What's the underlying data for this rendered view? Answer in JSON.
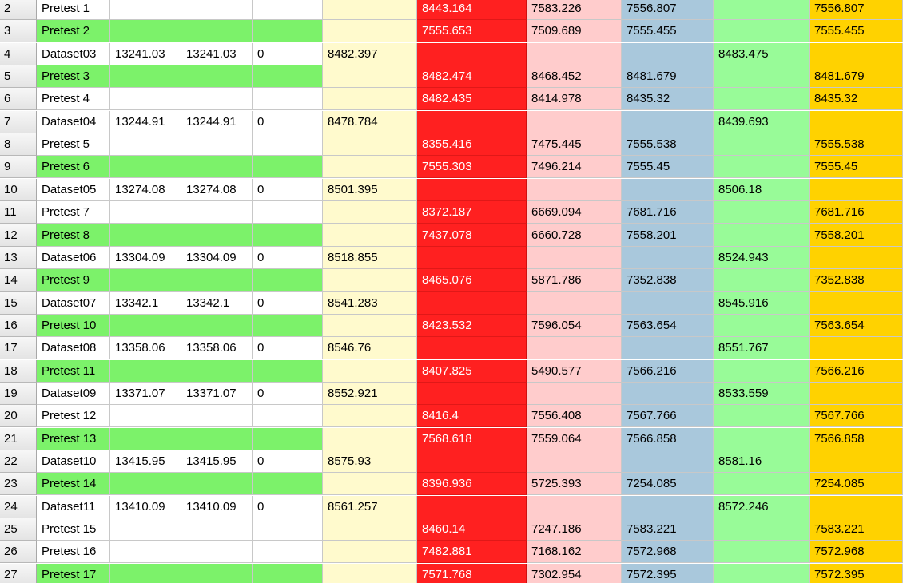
{
  "colors": {
    "row_highlight": "#7cf26a",
    "col_e": "#fffacd",
    "col_f": "#ff2020",
    "col_g": "#ffcccc",
    "col_h": "#a9c8dc",
    "col_i": "#98fb98",
    "col_j": "#ffd200"
  },
  "rows": [
    {
      "num": "2",
      "hl": false,
      "cells": [
        "Pretest  1",
        "",
        "",
        "",
        "",
        "8443.164",
        "7583.226",
        "7556.807",
        "",
        "7556.807"
      ]
    },
    {
      "num": "3",
      "hl": true,
      "cells": [
        "Pretest  2",
        "",
        "",
        "",
        "",
        "7555.653",
        "7509.689",
        "7555.455",
        "",
        "7555.455"
      ]
    },
    {
      "num": "4",
      "hl": false,
      "cells": [
        "Dataset03",
        "13241.03",
        "13241.03",
        "0",
        "8482.397",
        "",
        "",
        "",
        "8483.475",
        ""
      ]
    },
    {
      "num": "5",
      "hl": true,
      "cells": [
        "Pretest  3",
        "",
        "",
        "",
        "",
        "8482.474",
        "8468.452",
        "8481.679",
        "",
        "8481.679"
      ]
    },
    {
      "num": "6",
      "hl": false,
      "cells": [
        "Pretest  4",
        "",
        "",
        "",
        "",
        "8482.435",
        "8414.978",
        "8435.32",
        "",
        "8435.32"
      ]
    },
    {
      "num": "7",
      "hl": false,
      "cells": [
        "Dataset04",
        "13244.91",
        "13244.91",
        "0",
        "8478.784",
        "",
        "",
        "",
        "8439.693",
        ""
      ]
    },
    {
      "num": "8",
      "hl": false,
      "cells": [
        "Pretest  5",
        "",
        "",
        "",
        "",
        "8355.416",
        "7475.445",
        "7555.538",
        "",
        "7555.538"
      ]
    },
    {
      "num": "9",
      "hl": true,
      "cells": [
        "Pretest  6",
        "",
        "",
        "",
        "",
        "7555.303",
        "7496.214",
        "7555.45",
        "",
        "7555.45"
      ]
    },
    {
      "num": "10",
      "hl": false,
      "cells": [
        "Dataset05",
        "13274.08",
        "13274.08",
        "0",
        "8501.395",
        "",
        "",
        "",
        "8506.18",
        ""
      ]
    },
    {
      "num": "11",
      "hl": false,
      "cells": [
        "Pretest  7",
        "",
        "",
        "",
        "",
        "8372.187",
        "6669.094",
        "7681.716",
        "",
        "7681.716"
      ]
    },
    {
      "num": "12",
      "hl": true,
      "cells": [
        "Pretest  8",
        "",
        "",
        "",
        "",
        "7437.078",
        "6660.728",
        "7558.201",
        "",
        "7558.201"
      ]
    },
    {
      "num": "13",
      "hl": false,
      "cells": [
        "Dataset06",
        "13304.09",
        "13304.09",
        "0",
        "8518.855",
        "",
        "",
        "",
        "8524.943",
        ""
      ]
    },
    {
      "num": "14",
      "hl": true,
      "cells": [
        "Pretest  9",
        "",
        "",
        "",
        "",
        "8465.076",
        "5871.786",
        "7352.838",
        "",
        "7352.838"
      ]
    },
    {
      "num": "15",
      "hl": false,
      "cells": [
        "Dataset07",
        "13342.1",
        "13342.1",
        "0",
        "8541.283",
        "",
        "",
        "",
        "8545.916",
        ""
      ]
    },
    {
      "num": "16",
      "hl": true,
      "cells": [
        "Pretest  10",
        "",
        "",
        "",
        "",
        "8423.532",
        "7596.054",
        "7563.654",
        "",
        "7563.654"
      ]
    },
    {
      "num": "17",
      "hl": false,
      "cells": [
        "Dataset08",
        "13358.06",
        "13358.06",
        "0",
        "8546.76",
        "",
        "",
        "",
        "8551.767",
        ""
      ]
    },
    {
      "num": "18",
      "hl": true,
      "cells": [
        "Pretest  11",
        "",
        "",
        "",
        "",
        "8407.825",
        "5490.577",
        "7566.216",
        "",
        "7566.216"
      ]
    },
    {
      "num": "19",
      "hl": false,
      "cells": [
        "Dataset09",
        "13371.07",
        "13371.07",
        "0",
        "8552.921",
        "",
        "",
        "",
        "8533.559",
        ""
      ]
    },
    {
      "num": "20",
      "hl": false,
      "cells": [
        "Pretest  12",
        "",
        "",
        "",
        "",
        "8416.4",
        "7556.408",
        "7567.766",
        "",
        "7567.766"
      ]
    },
    {
      "num": "21",
      "hl": true,
      "cells": [
        "Pretest  13",
        "",
        "",
        "",
        "",
        "7568.618",
        "7559.064",
        "7566.858",
        "",
        "7566.858"
      ]
    },
    {
      "num": "22",
      "hl": false,
      "cells": [
        "Dataset10",
        "13415.95",
        "13415.95",
        "0",
        "8575.93",
        "",
        "",
        "",
        "8581.16",
        ""
      ]
    },
    {
      "num": "23",
      "hl": true,
      "cells": [
        "Pretest  14",
        "",
        "",
        "",
        "",
        "8396.936",
        "5725.393",
        "7254.085",
        "",
        "7254.085"
      ]
    },
    {
      "num": "24",
      "hl": false,
      "cells": [
        "Dataset11",
        "13410.09",
        "13410.09",
        "0",
        "8561.257",
        "",
        "",
        "",
        "8572.246",
        ""
      ]
    },
    {
      "num": "25",
      "hl": false,
      "cells": [
        "Pretest  15",
        "",
        "",
        "",
        "",
        "8460.14",
        "7247.186",
        "7583.221",
        "",
        "7583.221"
      ]
    },
    {
      "num": "26",
      "hl": false,
      "cells": [
        "Pretest  16",
        "",
        "",
        "",
        "",
        "7482.881",
        "7168.162",
        "7572.968",
        "",
        "7572.968"
      ]
    },
    {
      "num": "27",
      "hl": true,
      "cells": [
        "Pretest  17",
        "",
        "",
        "",
        "",
        "7571.768",
        "7302.954",
        "7572.395",
        "",
        "7572.395"
      ]
    }
  ]
}
